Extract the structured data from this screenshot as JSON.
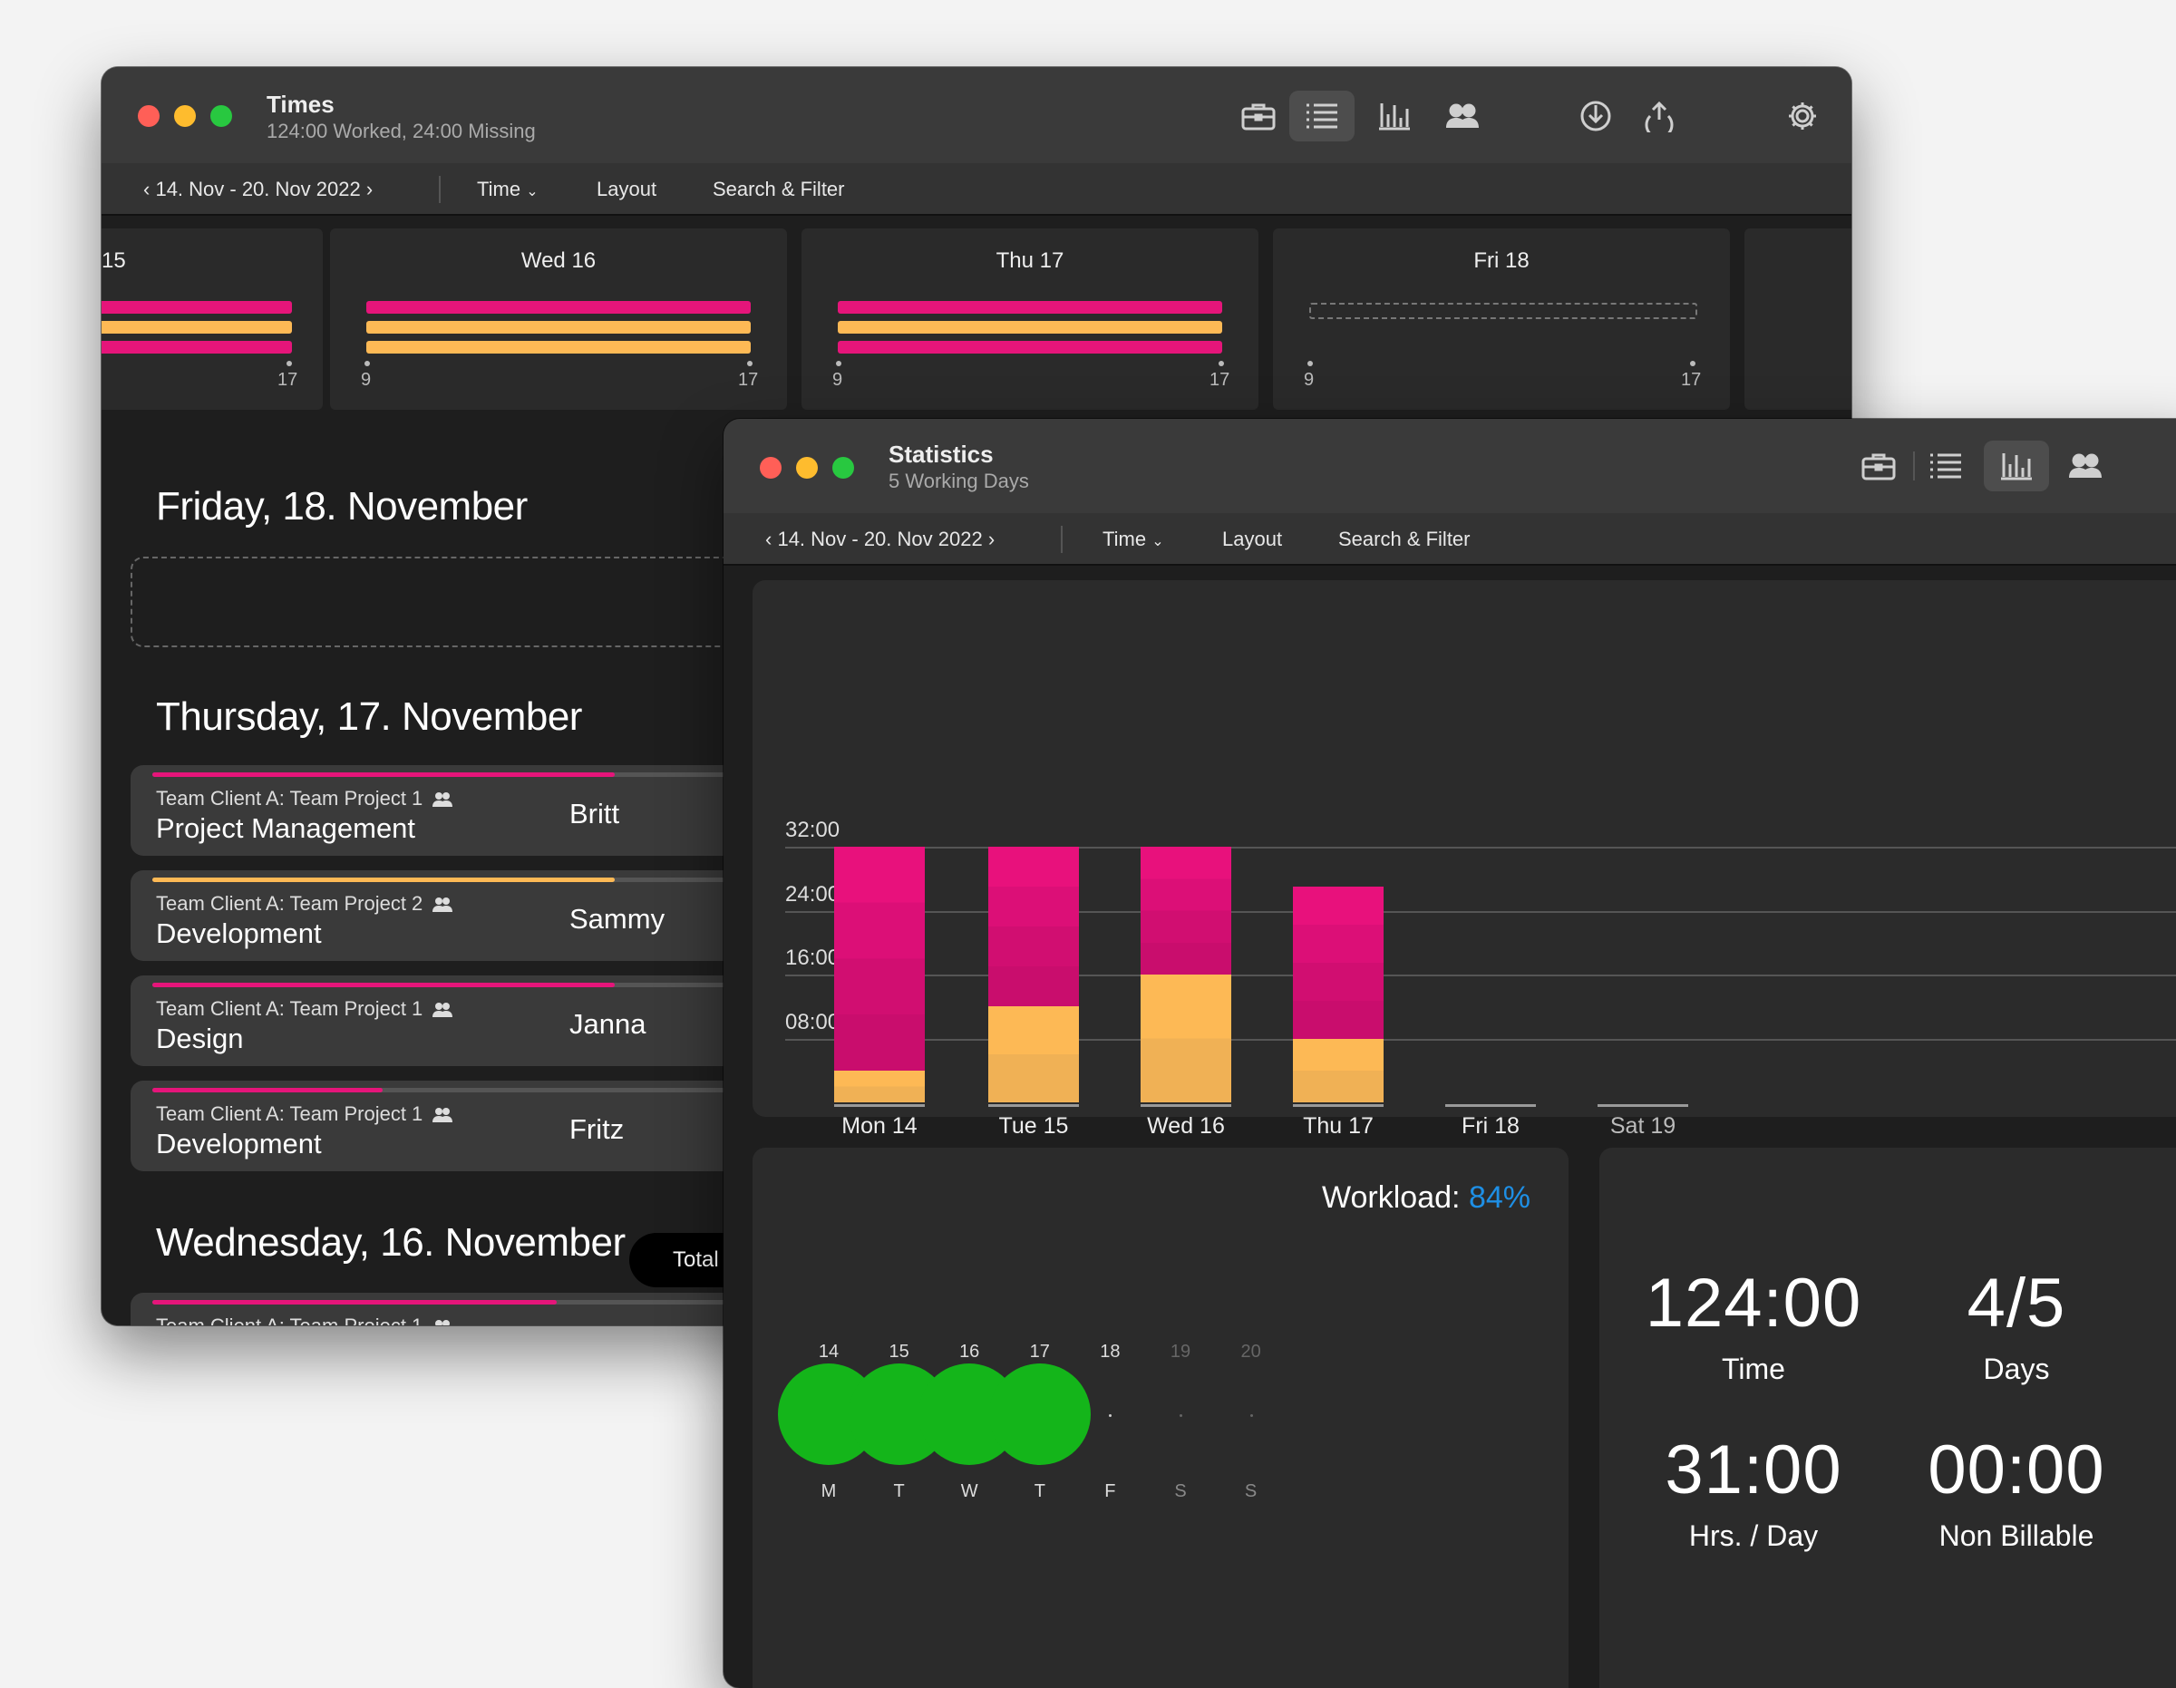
{
  "colors": {
    "magenta": "#e5157a",
    "orange": "#fdb955",
    "green": "#14b51a",
    "blue": "#1e8fe5",
    "close": "#ff5f57",
    "minimize": "#febc2e",
    "zoom": "#28c840"
  },
  "times_window": {
    "title": "Times",
    "subtitle": "124:00 Worked, 24:00 Missing",
    "toolbar_icons": [
      "briefcase-icon",
      "list-icon",
      "bar-chart-icon",
      "people-icon",
      "download-icon",
      "upload-icon",
      "gear-icon"
    ],
    "date_range": "14. Nov - 20. Nov 2022",
    "time_menu": "Time",
    "layout_label": "Layout",
    "search_label": "Search & Filter",
    "day_cards": [
      {
        "label": "15",
        "start": "",
        "end": "17"
      },
      {
        "label": "Wed 16",
        "start": "9",
        "end": "17"
      },
      {
        "label": "Thu 17",
        "start": "9",
        "end": "17"
      },
      {
        "label": "Fri 18",
        "start": "9",
        "end": "17"
      }
    ],
    "sections": {
      "friday": "Friday, 18. November",
      "thursday": "Thursday, 17. November",
      "wednesday": "Wednesday, 16. November"
    },
    "entries": [
      {
        "project": "Team Client A: Team Project 1",
        "task": "Project Management",
        "person": "Britt",
        "progress": 0.63
      },
      {
        "project": "Team Client A: Team Project 2",
        "task": "Development",
        "person": "Sammy",
        "progress": 0.63
      },
      {
        "project": "Team Client A: Team Project 1",
        "task": "Design",
        "person": "Janna",
        "progress": 0.63
      },
      {
        "project": "Team Client A: Team Project 1",
        "task": "Development",
        "person": "Fritz",
        "progress": 0.33
      }
    ],
    "wednesday_entry_project": "Team Client A: Team Project 1",
    "total_label": "Total"
  },
  "stats_window": {
    "title": "Statistics",
    "subtitle": "5 Working Days",
    "toolbar_icons": [
      "briefcase-icon",
      "list-icon",
      "bar-chart-icon",
      "people-icon"
    ],
    "date_range": "14. Nov - 20. Nov 2022",
    "time_menu": "Time",
    "layout_label": "Layout",
    "search_label": "Search & Filter",
    "workload_label": "Workload:",
    "workload_value": "84%",
    "week": [
      {
        "num": "14",
        "letter": "M",
        "worked": true
      },
      {
        "num": "15",
        "letter": "T",
        "worked": true
      },
      {
        "num": "16",
        "letter": "W",
        "worked": true
      },
      {
        "num": "17",
        "letter": "T",
        "worked": true
      },
      {
        "num": "18",
        "letter": "F",
        "worked": false
      },
      {
        "num": "19",
        "letter": "S",
        "worked": false
      },
      {
        "num": "20",
        "letter": "S",
        "worked": false
      }
    ],
    "summary": {
      "time_value": "124:00",
      "time_label": "Time",
      "days_value": "4/5",
      "days_label": "Days",
      "hrs_value": "31:00",
      "hrs_label": "Hrs. / Day",
      "nonbill_value": "00:00",
      "nonbill_label": "Non Billable"
    }
  },
  "chart_data": {
    "type": "bar",
    "stacked": true,
    "categories": [
      "Mon 14",
      "Tue 15",
      "Wed 16",
      "Thu 17",
      "Fri 18",
      "Sat 19"
    ],
    "yticks": [
      "08:00",
      "16:00",
      "24:00",
      "32:00"
    ],
    "ylim": [
      0,
      32
    ],
    "series": [
      {
        "color": "#fdb955",
        "values": [
          4,
          12,
          16,
          8,
          0,
          0
        ]
      },
      {
        "color": "#e5157a",
        "values": [
          28,
          20,
          16,
          19,
          0,
          0
        ]
      }
    ],
    "grid": true
  }
}
